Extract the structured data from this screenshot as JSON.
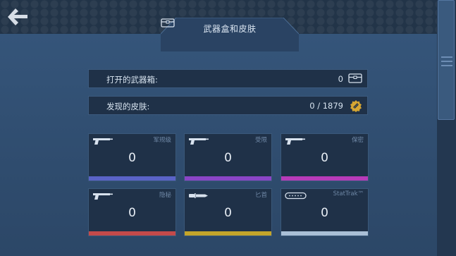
{
  "header": {
    "title": "武器盒和皮肤"
  },
  "stats": {
    "cases_opened": {
      "label": "打开的武器箱:",
      "value": "0"
    },
    "skins_found": {
      "label": "发现的皮肤:",
      "value": "0 / 1879"
    }
  },
  "rarities": [
    {
      "label": "军规级",
      "count": "0",
      "color": "#5a63c7",
      "icon": "pistol-icon"
    },
    {
      "label": "受限",
      "count": "0",
      "color": "#8a45c6",
      "icon": "pistol-icon"
    },
    {
      "label": "保密",
      "count": "0",
      "color": "#b73bb9",
      "icon": "pistol-icon"
    },
    {
      "label": "隐秘",
      "count": "0",
      "color": "#c44a4a",
      "icon": "pistol-icon"
    },
    {
      "label": "匕首",
      "count": "0",
      "color": "#c4a52a",
      "icon": "knife-icon"
    },
    {
      "label": "StatTrak™",
      "count": "0",
      "color": "#a9bfd6",
      "icon": "stattrak-counter-icon"
    }
  ],
  "colors": {
    "panel": "#2f4c6e",
    "card": "#1f3148",
    "accent_gold": "#d6a632"
  }
}
